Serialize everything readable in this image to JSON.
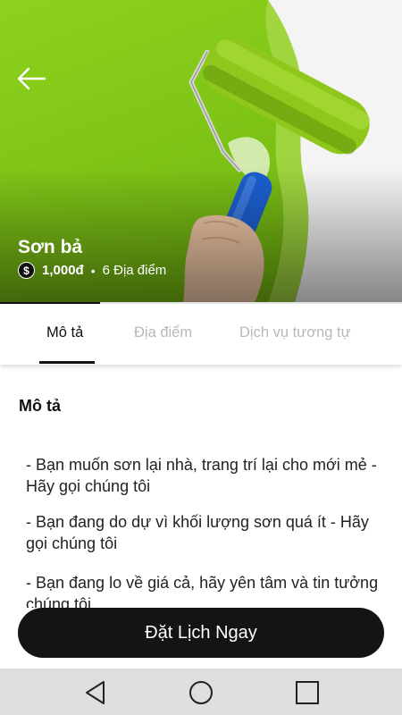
{
  "hero": {
    "title": "Sơn bả",
    "price": "1,000đ",
    "separator": "•",
    "locations": "6 Địa điểm",
    "currency_symbol": "$"
  },
  "tabs": [
    {
      "label": "Mô tả",
      "active": true
    },
    {
      "label": "Địa điểm",
      "active": false
    },
    {
      "label": "Dịch vụ tương tự",
      "active": false
    }
  ],
  "content": {
    "section_title": "Mô tả",
    "paragraphs": [
      "- Bạn muốn sơn lại nhà, trang trí lại cho mới mẻ - Hãy gọi chúng tôi",
      "- Bạn đang do dự vì khối lượng sơn quá ít - Hãy gọi chúng tôi",
      "- Bạn đang lo về giá cả, hãy yên tâm và tin tưởng chúng tôi"
    ]
  },
  "cta": {
    "label": "Đặt Lịch Ngay"
  },
  "colors": {
    "accent": "#141414",
    "paint_green": "#8fd21d",
    "roller_blue": "#1c5fd1"
  },
  "icons": {
    "back": "arrow-left-icon",
    "nav": [
      "back-triangle-icon",
      "home-circle-icon",
      "recents-square-icon"
    ]
  }
}
